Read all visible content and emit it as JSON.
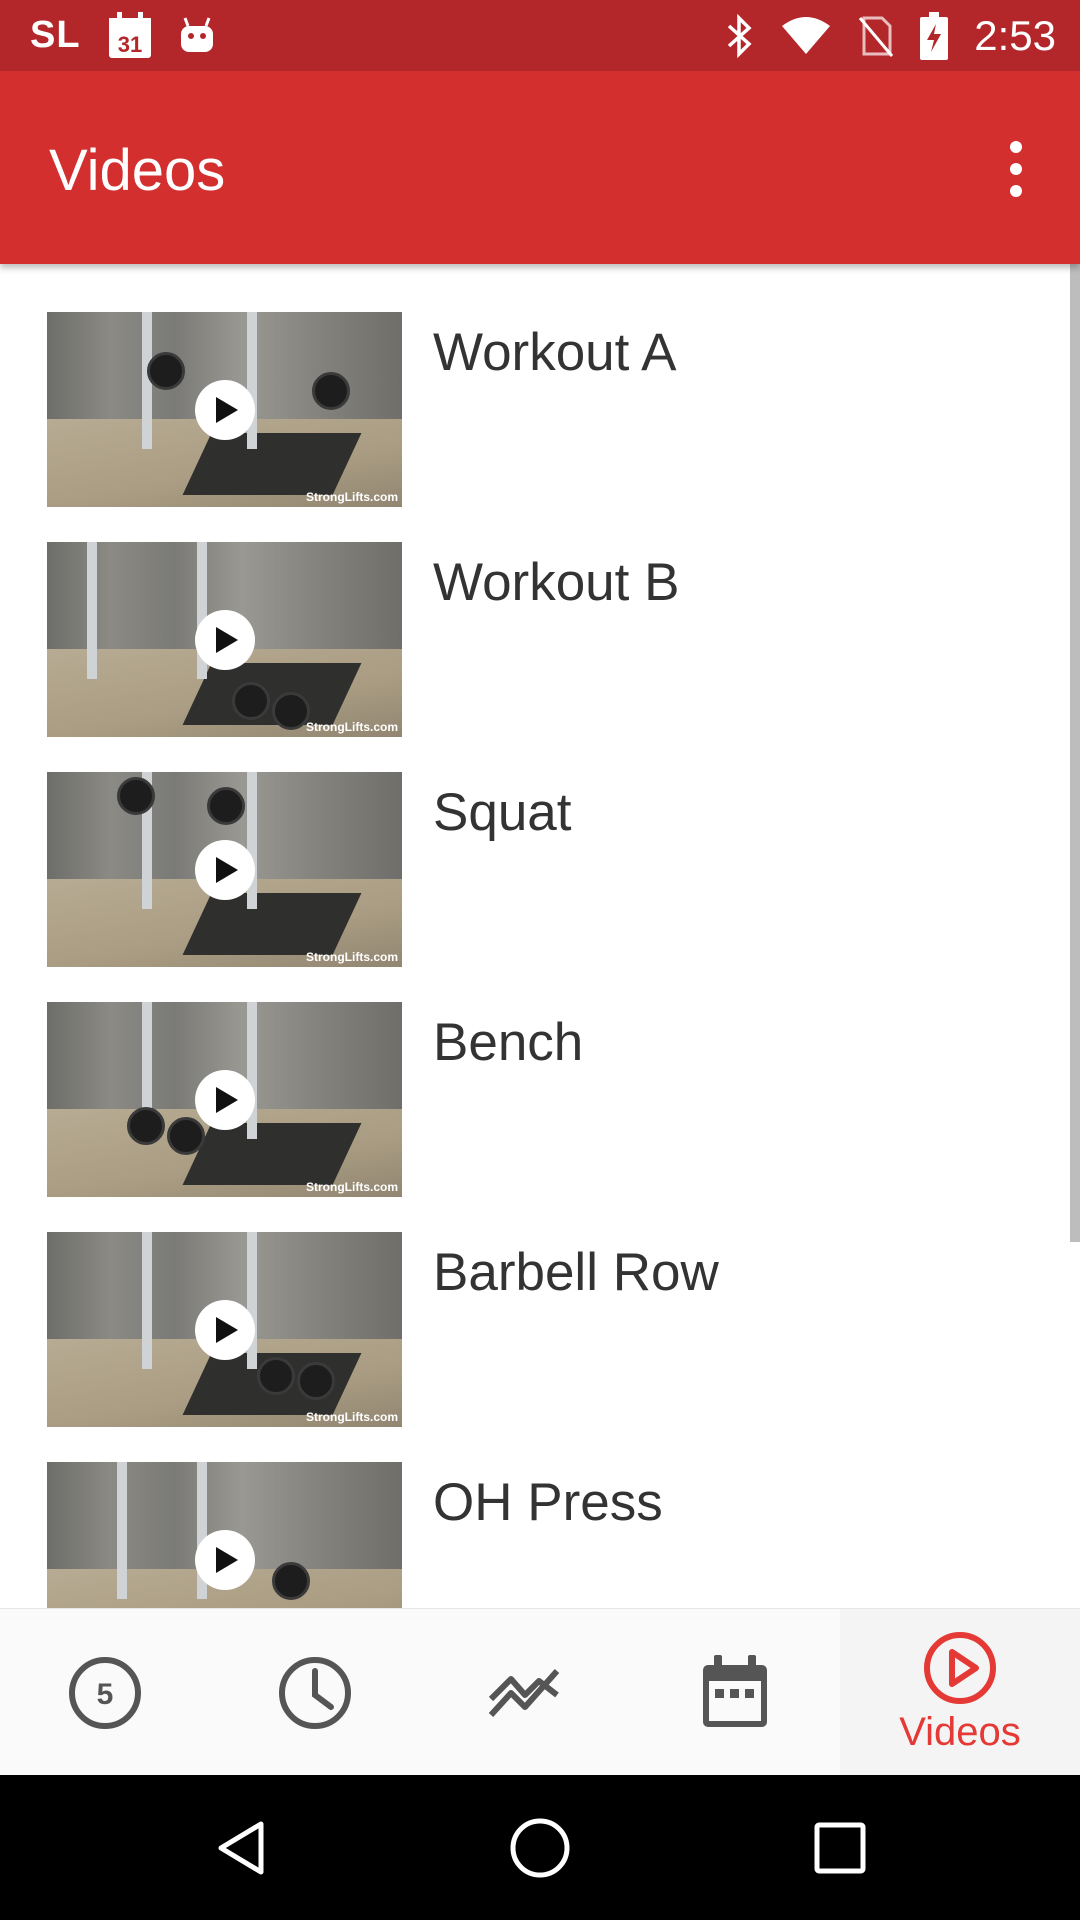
{
  "status_bar": {
    "carrier": "SL",
    "calendar_day": "31",
    "time": "2:53",
    "icons": [
      "calendar-icon",
      "android-icon",
      "bluetooth-icon",
      "wifi-icon",
      "no-sim-icon",
      "battery-charging-icon"
    ]
  },
  "app_bar": {
    "title": "Videos",
    "menu_icon": "more-vert-icon"
  },
  "videos": [
    {
      "title": "Workout A",
      "watermark": "StrongLifts.com"
    },
    {
      "title": "Workout B",
      "watermark": "StrongLifts.com"
    },
    {
      "title": "Squat",
      "watermark": "StrongLifts.com"
    },
    {
      "title": "Bench",
      "watermark": "StrongLifts.com"
    },
    {
      "title": "Barbell Row",
      "watermark": "StrongLifts.com"
    },
    {
      "title": "OH Press",
      "watermark": ""
    }
  ],
  "bottom_nav": {
    "items": [
      {
        "icon": "five-circle-icon",
        "badge": "5",
        "label": ""
      },
      {
        "icon": "clock-icon",
        "label": ""
      },
      {
        "icon": "chart-line-icon",
        "label": ""
      },
      {
        "icon": "calendar-icon",
        "label": ""
      },
      {
        "icon": "play-circle-icon",
        "label": "Videos",
        "active": true
      }
    ],
    "active_color": "#e53935",
    "inactive_color": "#555555"
  },
  "system_nav": {
    "buttons": [
      "back-icon",
      "home-icon",
      "recents-icon"
    ]
  },
  "colors": {
    "status_bar": "#b3272b",
    "app_bar": "#d32f2f",
    "accent": "#e53935"
  }
}
